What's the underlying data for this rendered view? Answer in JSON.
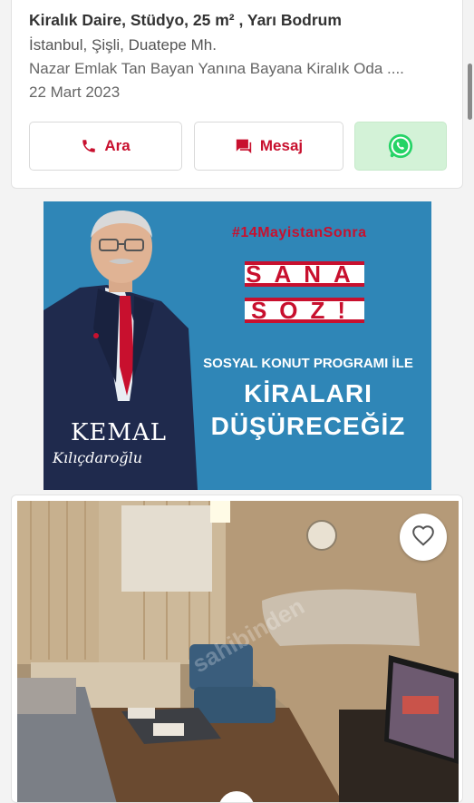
{
  "listing_card": {
    "title": "Kiralık Daire, Stüdyo, 25 m² , Yarı Bodrum",
    "location": "İstanbul, Şişli, Duatepe Mh.",
    "description": "Nazar Emlak Tan Bayan Yanına Bayana Kiralık Oda ....",
    "date": "22 Mart 2023",
    "call_label": "Ara",
    "message_label": "Mesaj",
    "whatsapp_icon": "whatsapp-icon",
    "accent_color": "#c8102e",
    "whatsapp_color": "#25d366"
  },
  "ad_banner": {
    "hashtag": "#14MayistanSonra",
    "slogan_line1": "SANA",
    "slogan_line2": "SÖZ!",
    "program_text": "SOSYAL KONUT PROGRAMI İLE",
    "headline_line1": "KİRALARI",
    "headline_line2": "DÜŞÜRECEĞİZ",
    "signature_name": "KEMAL",
    "signature_hand": "Kılıçdaroğlu",
    "background_color": "#2f86b7"
  },
  "listing_photo": {
    "favorite_icon": "heart-icon"
  }
}
